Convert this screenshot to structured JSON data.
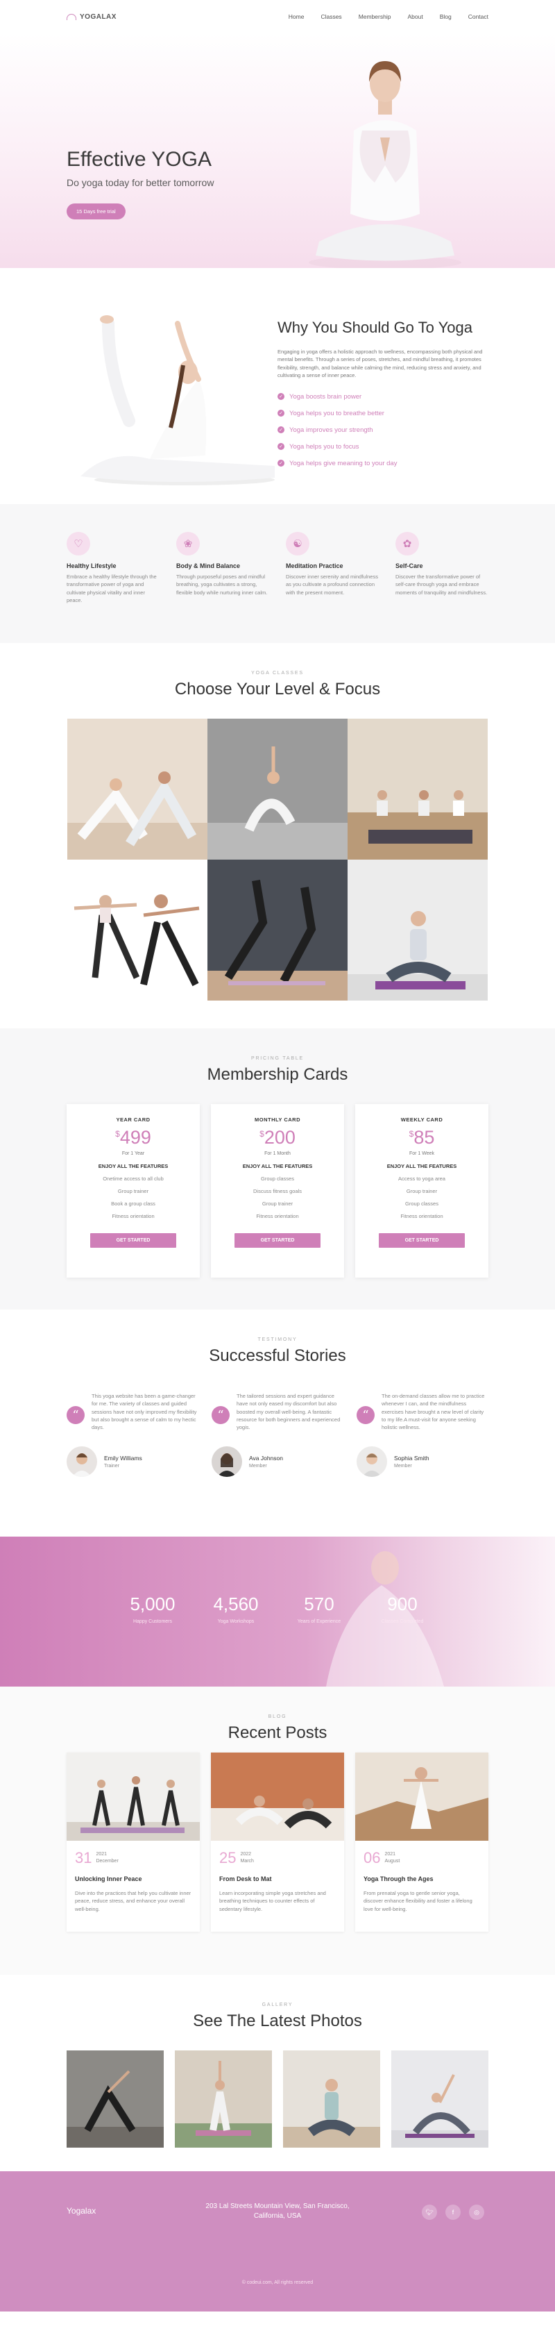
{
  "header": {
    "brand": "YOGALAX",
    "nav": [
      "Home",
      "Classes",
      "Membership",
      "About",
      "Blog",
      "Contact"
    ]
  },
  "hero": {
    "title": "Effective YOGA",
    "subtitle": "Do yoga today for better tomorrow",
    "cta": "15 Days free trial"
  },
  "why": {
    "title": "Why You Should Go To Yoga",
    "paragraph": "Engaging in yoga offers a holistic approach to wellness, encompassing both physical and mental benefits. Through a series of poses, stretches, and mindful breathing, it promotes flexibility, strength, and balance while calming the mind, reducing stress and anxiety, and cultivating a sense of inner peace.",
    "items": [
      "Yoga boosts brain power",
      "Yoga helps you to breathe better",
      "Yoga improves your strength",
      "Yoga helps you to focus",
      "Yoga helps give meaning to your day"
    ]
  },
  "features": [
    {
      "icon": "heart-icon",
      "title": "Healthy Lifestyle",
      "text": "Embrace a healthy lifestyle through the transformative power of yoga and cultivate physical vitality and inner peace."
    },
    {
      "icon": "lotus-icon",
      "title": "Body & Mind Balance",
      "text": "Through purposeful poses and mindful breathing, yoga cultivates a strong, flexible body while nurturing inner calm."
    },
    {
      "icon": "meditation-icon",
      "title": "Meditation Practice",
      "text": "Discover inner serenity and mindfulness as you cultivate a profound connection with the present moment."
    },
    {
      "icon": "self-care-icon",
      "title": "Self-Care",
      "text": "Discover the transformative power of self-care through yoga and embrace moments of tranquility and mindfulness."
    }
  ],
  "classes": {
    "kicker": "YOGA CLASSES",
    "title": "Choose Your Level & Focus"
  },
  "pricing": {
    "kicker": "PRICING TABLE",
    "title": "Membership Cards",
    "cards": [
      {
        "name": "YEAR CARD",
        "price": "499",
        "currency": "$",
        "period": "For 1 Year",
        "features_title": "ENJOY ALL THE FEATURES",
        "items": [
          "Onetime access to all club",
          "Group trainer",
          "Book a group class",
          "Fitness orientation"
        ],
        "button": "GET STARTED"
      },
      {
        "name": "MONTHLY CARD",
        "price": "200",
        "currency": "$",
        "period": "For 1 Month",
        "features_title": "ENJOY ALL THE FEATURES",
        "items": [
          "Group classes",
          "Discuss fitness goals",
          "Group trainer",
          "Fitness orientation"
        ],
        "button": "GET STARTED"
      },
      {
        "name": "WEEKLY CARD",
        "price": "85",
        "currency": "$",
        "period": "For 1 Week",
        "features_title": "ENJOY ALL THE FEATURES",
        "items": [
          "Access to yoga area",
          "Group trainer",
          "Group classes",
          "Fitness orientation"
        ],
        "button": "GET STARTED"
      }
    ]
  },
  "testimonials": {
    "kicker": "TESTIMONY",
    "title": "Successful Stories",
    "items": [
      {
        "text": "This yoga website has been a game-changer for me. The variety of classes and guided sessions have not only improved my flexibility but also brought a sense of calm to my hectic days.",
        "name": "Emily Williams",
        "role": "Trainer"
      },
      {
        "text": "The tailored sessions and expert guidance have not only eased my discomfort but also boosted my overall well-being. A fantastic resource for both beginners and experienced yogis.",
        "name": "Ava Johnson",
        "role": "Member"
      },
      {
        "text": "The on-demand classes allow me to practice whenever I can, and the mindfulness exercises have brought a new level of clarity to my life.A must-visit for anyone seeking holistic wellness.",
        "name": "Sophia Smith",
        "role": "Member"
      }
    ]
  },
  "stats": [
    {
      "value": "5,000",
      "label": "Happy Customers"
    },
    {
      "value": "4,560",
      "label": "Yoga Workshops"
    },
    {
      "value": "570",
      "label": "Years of Experience"
    },
    {
      "value": "900",
      "label": "Classes Completed"
    }
  ],
  "blog": {
    "kicker": "BLOG",
    "title": "Recent Posts",
    "posts": [
      {
        "day": "31",
        "year": "2021",
        "month": "December",
        "title": "Unlocking Inner Peace",
        "text": "Dive into the practices that help you cultivate inner peace, reduce stress, and enhance your overall well-being."
      },
      {
        "day": "25",
        "year": "2022",
        "month": "March",
        "title": "From Desk to Mat",
        "text": "Learn incorporating simple yoga stretches and breathing techniques to counter effects of sedentary lifestyle."
      },
      {
        "day": "06",
        "year": "2021",
        "month": "August",
        "title": "Yoga Through the Ages",
        "text": "From prenatal yoga to gentle senior yoga, discover enhance flexibility and foster a lifelong love for well-being."
      }
    ]
  },
  "gallery": {
    "kicker": "GALLERY",
    "title": "See The Latest Photos"
  },
  "footer": {
    "brand": "Yogalax",
    "address_line1": "203 Lal Streets Mountain View, San Francisco,",
    "address_line2": "California, USA",
    "social": [
      "twitter-icon",
      "facebook-icon",
      "instagram-icon"
    ],
    "copyright": "© codeui.com, All rights reserved"
  },
  "colors": {
    "accent": "#cf7fb8",
    "accent_light": "#f6dfee",
    "footer": "#cf8ec0"
  }
}
